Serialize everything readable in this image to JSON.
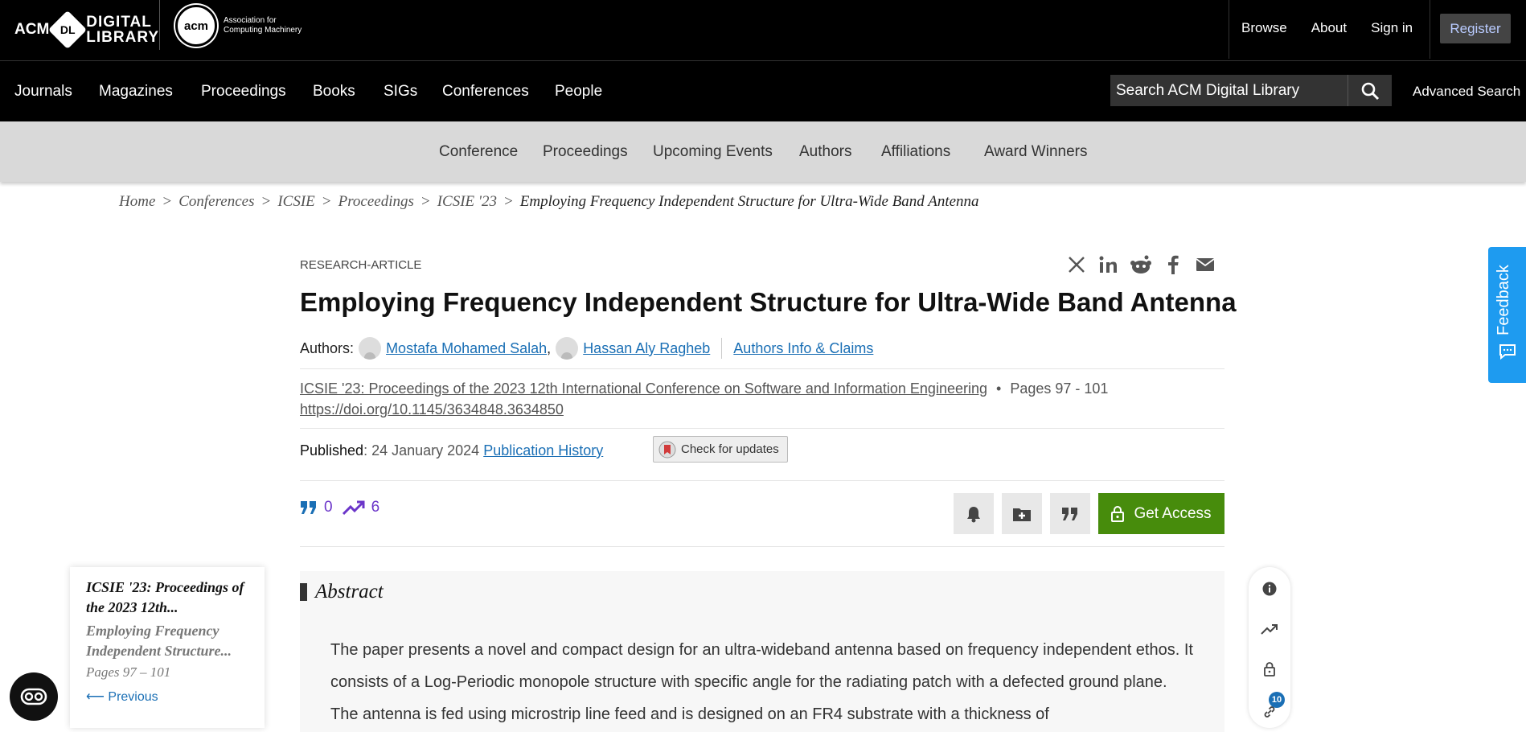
{
  "header": {
    "logo_acm": "ACM",
    "logo_dl": "DL",
    "logo_digital": "DIGITAL",
    "logo_library": "LIBRARY",
    "acm_circle": "acm",
    "acm_text_1": "Association for",
    "acm_text_2": "Computing Machinery",
    "links": [
      "Browse",
      "About",
      "Sign in"
    ],
    "register": "Register"
  },
  "nav": {
    "items": [
      "Journals",
      "Magazines",
      "Proceedings",
      "Books",
      "SIGs",
      "Conferences",
      "People"
    ],
    "search_placeholder": "Search ACM Digital Library",
    "advanced_search": "Advanced Search"
  },
  "subnav": {
    "items": [
      "Conference",
      "Proceedings",
      "Upcoming Events",
      "Authors",
      "Affiliations",
      "Award Winners"
    ]
  },
  "breadcrumb": {
    "items": [
      "Home",
      "Conferences",
      "ICSIE",
      "Proceedings",
      "ICSIE '23"
    ],
    "separator": ">",
    "current": "Employing Frequency Independent Structure for Ultra-Wide Band Antenna"
  },
  "article": {
    "type": "RESEARCH-ARTICLE",
    "title": "Employing Frequency Independent Structure for Ultra-Wide Band Antenna",
    "authors_label": "Authors",
    "authors": [
      "Mostafa Mohamed Salah",
      "Hassan Aly Ragheb"
    ],
    "authors_info": "Authors Info & Claims",
    "proceedings": "ICSIE '23: Proceedings of the 2023 12th International Conference on Software and Information Engineering",
    "pages": "Pages 97 - 101",
    "doi": "https://doi.org/10.1145/3634848.3634850",
    "published_label": "Published",
    "published_date": "24 January 2024",
    "publication_history": "Publication History",
    "check_updates": "Check for updates",
    "citations": "0",
    "downloads": "6",
    "get_access": "Get Access"
  },
  "card": {
    "proceedings": "ICSIE '23: Proceedings of the 2023 12th...",
    "title": "Employing Frequency Independent Structure...",
    "pages": "Pages 97 – 101",
    "previous": "Previous"
  },
  "abstract": {
    "heading": "Abstract",
    "text": "The paper presents a novel and compact design for an ultra-wideband antenna based on frequency independent ethos. It consists of a Log-Periodic monopole structure with specific angle for the radiating patch with a defected ground plane. The antenna is fed using microstrip line feed and is designed on an FR4 substrate with a thickness of"
  },
  "rail": {
    "badge": "10"
  },
  "feedback": "Feedback",
  "colors": {
    "accent": "#478c0c",
    "link": "#1a6fb5",
    "metrics": "#6b35c9",
    "feedback": "#1e9bf0"
  }
}
